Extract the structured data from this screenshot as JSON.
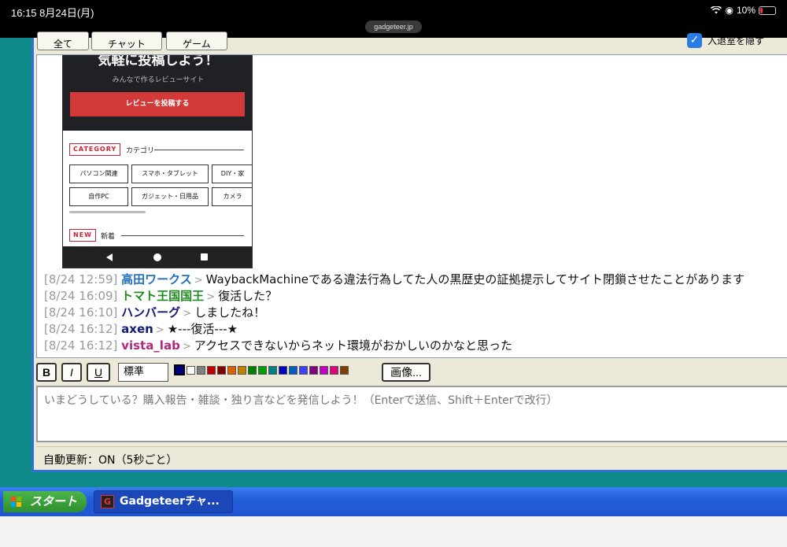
{
  "status_bar": {
    "time_date": "16:15  8月24日(月)",
    "url": "gadgeteer.jp",
    "battery": "10%"
  },
  "tabs": [
    {
      "label": "全て"
    },
    {
      "label": "チャット"
    },
    {
      "label": "ゲーム"
    }
  ],
  "hide_toggle": {
    "label": "入退室を隠す",
    "checked": true
  },
  "screenshot": {
    "hero_title": "気軽に投稿しよう！",
    "hero_subtitle": "みんなで作るレビューサイト",
    "post_button": "レビューを投稿する",
    "category_tag": "CATEGORY",
    "category_label": "カテゴリ",
    "categories": [
      "パソコン関連",
      "スマホ・タブレット",
      "DIY・家",
      "自作PC",
      "ガジェット・日用品",
      "カメラ"
    ],
    "new_tag": "NEW",
    "new_label": "新着"
  },
  "messages": [
    {
      "time": "[8/24 12:59]",
      "name": "高田ワークス",
      "name_color": "#1f6fc0",
      "text": "WaybackMachineである違法行為してた人の黒歴史の証拠提示してサイト閉鎖させたことがあります"
    },
    {
      "time": "[8/24 16:09]",
      "name": "トマト王国国王",
      "name_color": "#1f8a1f",
      "text": "復活した？"
    },
    {
      "time": "[8/24 16:10]",
      "name": "ハンバーグ",
      "name_color": "#101a78",
      "text": "しましたね！"
    },
    {
      "time": "[8/24 16:12]",
      "name": "axen",
      "name_color": "#101a78",
      "text": "★---復活---★"
    },
    {
      "time": "[8/24 16:12]",
      "name": "vista_lab",
      "name_color": "#b0287a",
      "text": "アクセスできないからネット環境がおかしいのかなと思った"
    }
  ],
  "toolbar": {
    "bold": "B",
    "italic": "I",
    "underline": "U",
    "size_select": "標準",
    "colors": [
      "#000080",
      "#ffffff",
      "#808080",
      "#c00000",
      "#800000",
      "#e06000",
      "#c08000",
      "#008000",
      "#00a000",
      "#008080",
      "#0000c0",
      "#0060c0",
      "#4040ff",
      "#800080",
      "#c000c0",
      "#e00080",
      "#804000"
    ],
    "image_button": "画像..."
  },
  "input": {
    "placeholder": "いまどうしている？購入報告・雑談・独り言などを発信しよう！（Enterで送信、Shift＋Enterで改行）"
  },
  "footer": {
    "auto_update": "自動更新：ON（5秒ごと）"
  },
  "taskbar": {
    "start": "スタート",
    "task_item": "Gadgeteerチャ..."
  }
}
